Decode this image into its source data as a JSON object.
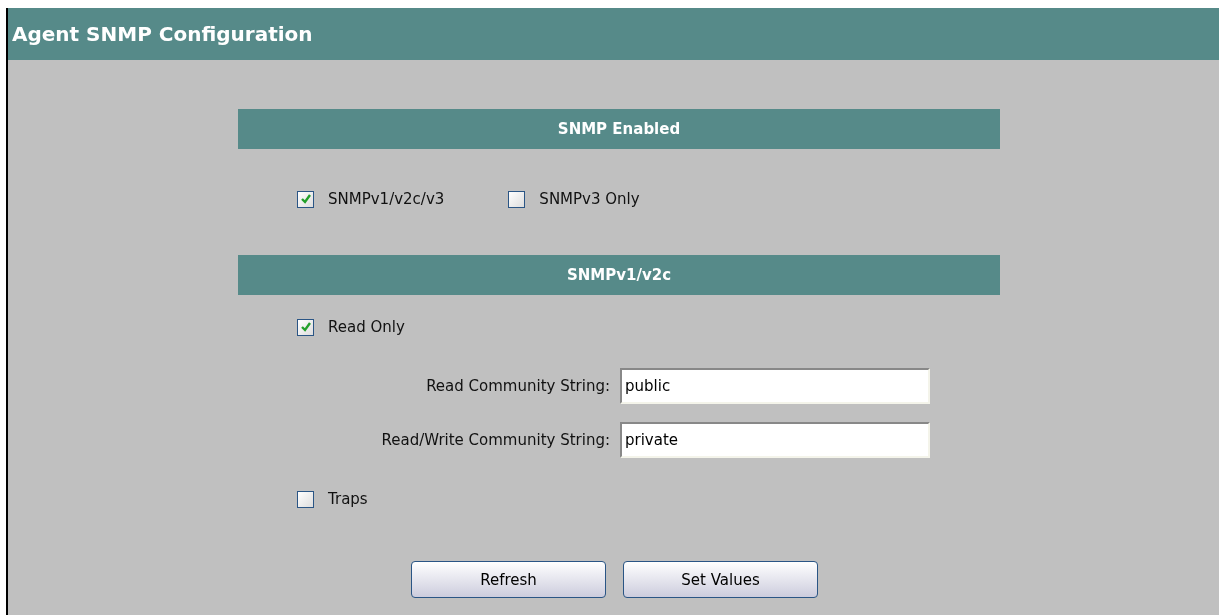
{
  "title": "Agent SNMP Configuration",
  "sections": [
    {
      "heading": "SNMP Enabled",
      "rows": [
        {
          "kind": "checks",
          "items": [
            {
              "label": "SNMPv1/v2c/v3",
              "checked": true
            },
            {
              "label": "SNMPv3 Only",
              "checked": false
            }
          ]
        }
      ]
    },
    {
      "heading": "SNMPv1/v2c",
      "rows": [
        {
          "kind": "checks",
          "items": [
            {
              "label": "Read Only",
              "checked": true
            }
          ]
        },
        {
          "kind": "field",
          "label": "Read Community String:",
          "value": "public"
        },
        {
          "kind": "field",
          "label": "Read/Write Community String:",
          "value": "private"
        },
        {
          "kind": "checks",
          "items": [
            {
              "label": "Traps",
              "checked": false
            }
          ]
        }
      ]
    }
  ],
  "buttons": [
    "Refresh",
    "Set Values"
  ]
}
